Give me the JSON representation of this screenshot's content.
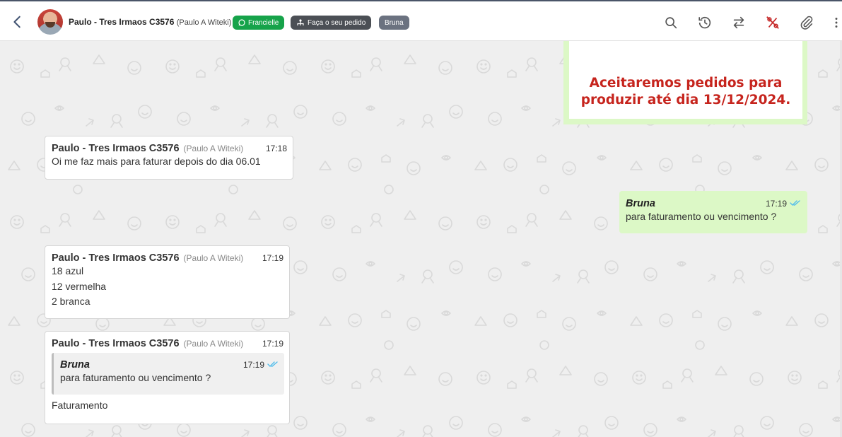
{
  "header": {
    "contact_name": "Paulo - Tres Irmaos C3576",
    "contact_alias": "(Paulo A Witeki)",
    "tags": [
      {
        "label": "Francielle",
        "icon": "whatsapp-icon",
        "color": "#16a34a"
      },
      {
        "label": "Faça o seu pedido",
        "icon": "network-icon",
        "color": "#4b4f55"
      },
      {
        "label": "Bruna",
        "color": "#6b7280"
      }
    ],
    "actions": [
      "search-icon",
      "history-icon",
      "transfer-icon",
      "percent-off-icon",
      "paperclip-icon",
      "more-icon"
    ]
  },
  "image_message": {
    "line1": "Aceitaremos pedidos para",
    "line2": "produzir até dia 13/12/2024."
  },
  "messages": [
    {
      "sender": "Paulo - Tres Irmaos C3576",
      "alias": "(Paulo A Witeki)",
      "time": "17:18",
      "text": "Oi me faz mais para faturar depois do dia 06.01"
    },
    {
      "sender": "Bruna",
      "time": "17:19",
      "text": "para faturamento ou vencimento ?",
      "status": "read"
    },
    {
      "sender": "Paulo - Tres Irmaos C3576",
      "alias": "(Paulo A Witeki)",
      "time": "17:19",
      "lines": [
        "18 azul",
        "12 vermelha",
        "2 branca"
      ]
    },
    {
      "sender": "Paulo - Tres Irmaos C3576",
      "alias": "(Paulo A Witeki)",
      "time": "17:19",
      "quoted": {
        "sender": "Bruna",
        "time": "17:19",
        "text": "para faturamento ou vencimento ?"
      },
      "text": "Faturamento"
    }
  ],
  "colors": {
    "incoming": "#ffffff",
    "outgoing": "#dcf8c6",
    "read_ticks": "#53bdeb",
    "alert_text": "#c6241d"
  }
}
